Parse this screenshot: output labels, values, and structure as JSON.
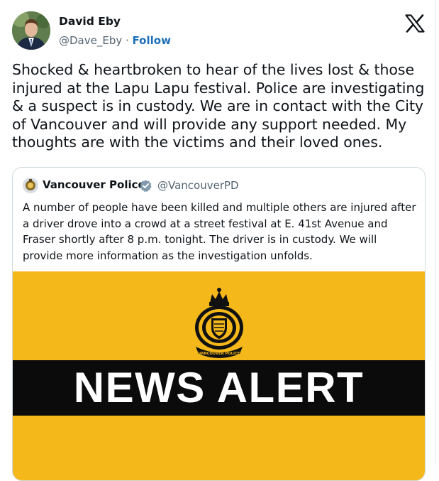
{
  "tweet": {
    "author": {
      "name": "David Eby",
      "handle": "@Dave_Eby",
      "separator": " · ",
      "follow_label": "Follow"
    },
    "text": "Shocked & heartbroken to hear of the lives lost & those injured at the Lapu Lapu festival. Police are investigating & a suspect is in custody. We are in contact with the City of Vancouver and will provide any support needed. My thoughts are with the victims and their loved ones."
  },
  "quoted_tweet": {
    "author": {
      "name": "Vancouver Police",
      "handle": "@VancouverPD",
      "verified": true
    },
    "text": "A number of people have been killed and multiple others are injured after a driver drove into a crowd at a street festival at E. 41st Avenue and Fraser shortly after 8 p.m. tonight. The driver is in custody. We will provide more information as the investigation unfolds.",
    "media": {
      "banner_text": "NEWS ALERT",
      "crest_text": "VANCOUVER POLICE",
      "background_color": "#f4b81a",
      "band_color": "#0b0b0b"
    }
  },
  "icons": {
    "platform_logo": "x-logo-icon",
    "verified_badge": "verified-badge-icon"
  },
  "colors": {
    "link": "#1d6fb8",
    "secondary_text": "#536471",
    "verified_badge": "#829aab"
  }
}
